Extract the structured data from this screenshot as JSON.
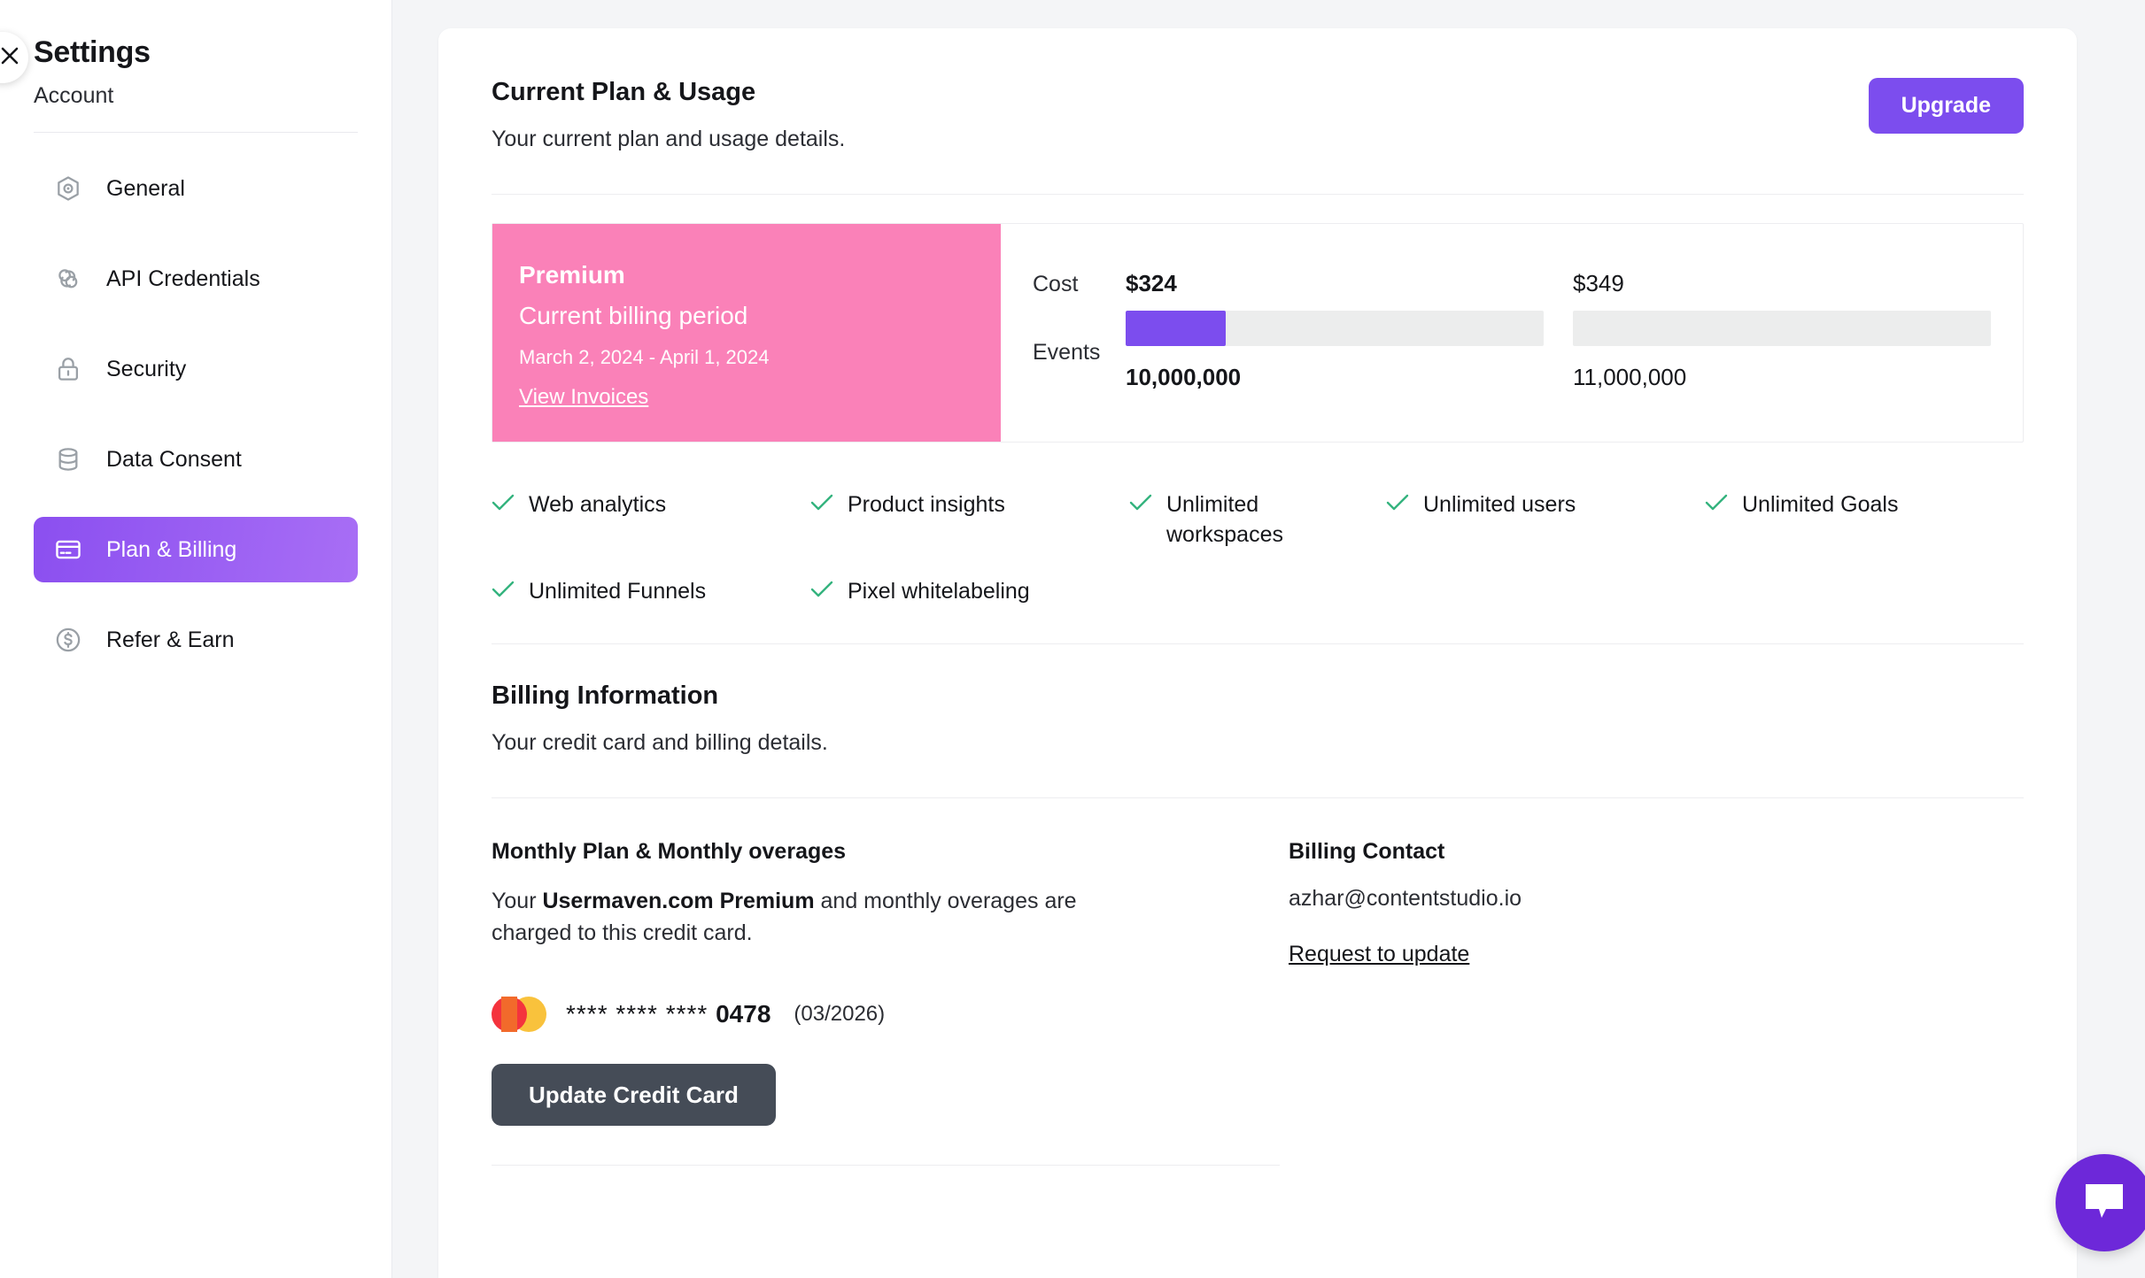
{
  "sidebar": {
    "title": "Settings",
    "subtitle": "Account",
    "close_icon": "close-icon",
    "items": [
      {
        "label": "General",
        "icon": "hexagon-target-icon",
        "active": false
      },
      {
        "label": "API Credentials",
        "icon": "chain-link-icon",
        "active": false
      },
      {
        "label": "Security",
        "icon": "lock-icon",
        "active": false
      },
      {
        "label": "Data Consent",
        "icon": "database-icon",
        "active": false
      },
      {
        "label": "Plan & Billing",
        "icon": "credit-card-icon",
        "active": true
      },
      {
        "label": "Refer & Earn",
        "icon": "dollar-circle-icon",
        "active": false
      }
    ]
  },
  "plan_section": {
    "title": "Current Plan & Usage",
    "description": "Your current plan and usage details.",
    "upgrade_label": "Upgrade",
    "plan": {
      "name": "Premium",
      "period_label": "Current billing period",
      "dates": "March 2, 2024 - April 1, 2024",
      "invoices_link": "View Invoices"
    },
    "usage": {
      "cost_label": "Cost",
      "events_label": "Events",
      "current": {
        "cost": "$324",
        "events": "10,000,000",
        "fill_percent": 24
      },
      "limit": {
        "cost": "$349",
        "events": "11,000,000",
        "fill_percent": 0
      }
    },
    "features_row1": [
      "Web analytics",
      "Product insights",
      "Unlimited workspaces",
      "Unlimited users",
      "Unlimited Goals"
    ],
    "features_row2": [
      "Unlimited Funnels",
      "Pixel whitelabeling"
    ]
  },
  "billing_section": {
    "title": "Billing Information",
    "description": "Your credit card and billing details.",
    "plan_col": {
      "heading": "Monthly Plan & Monthly overages",
      "text_before": "Your ",
      "text_bold": "Usermaven.com Premium",
      "text_after": " and monthly overages are charged to this credit card."
    },
    "contact_col": {
      "heading": "Billing Contact",
      "email": "azhar@contentstudio.io",
      "request_link": "Request to update"
    },
    "card": {
      "brand_icon": "mastercard-icon",
      "masked": "**** **** ****",
      "last4": "0478",
      "expiry": "(03/2026)",
      "update_label": "Update Credit Card"
    }
  },
  "chat": {
    "icon": "chat-bubble-icon"
  },
  "colors": {
    "accent_purple": "#7c4dee",
    "plan_pink": "#fa81b8",
    "check_green": "#34b37e",
    "dark_button": "#454c57",
    "chat_purple": "#6d28d9"
  }
}
